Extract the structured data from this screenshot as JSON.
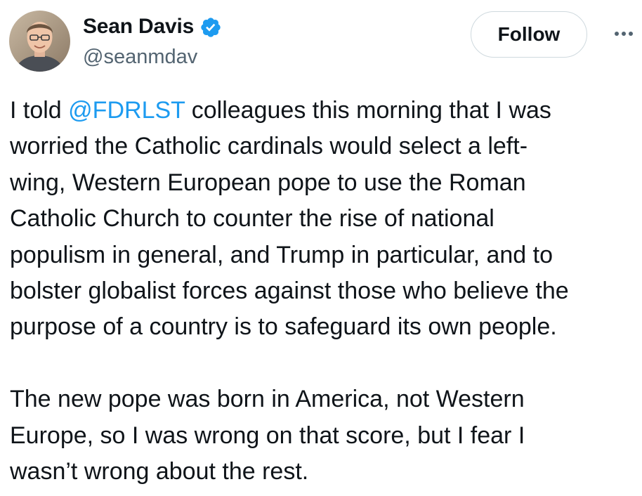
{
  "user": {
    "display_name": "Sean Davis",
    "handle": "@seanmdav",
    "verified": true
  },
  "actions": {
    "follow_label": "Follow",
    "more_icon": "more-horizontal-icon"
  },
  "tweet": {
    "paragraph1": {
      "line1_prefix": "I told ",
      "mention": "@FDRLST",
      "line1_suffix": " colleagues this morning that I was",
      "line2": "worried the Catholic cardinals would select a left-",
      "line3": "wing, Western European pope to use the Roman",
      "line4": "Catholic Church to counter the rise of national",
      "line5": "populism in general, and Trump in particular, and to",
      "line6": "bolster globalist forces against those who believe the",
      "line7": "purpose of a country is to safeguard its own people."
    },
    "paragraph2": {
      "line1": "The new pope was born in America, not Western",
      "line2": "Europe, so I was wrong on that score, but I fear I",
      "line3": "wasn’t wrong about the rest."
    }
  },
  "colors": {
    "link": "#1d9bf0",
    "verified": "#1d9bf0",
    "text": "#0f1419",
    "secondary": "#536471",
    "border": "#cfd9de"
  }
}
